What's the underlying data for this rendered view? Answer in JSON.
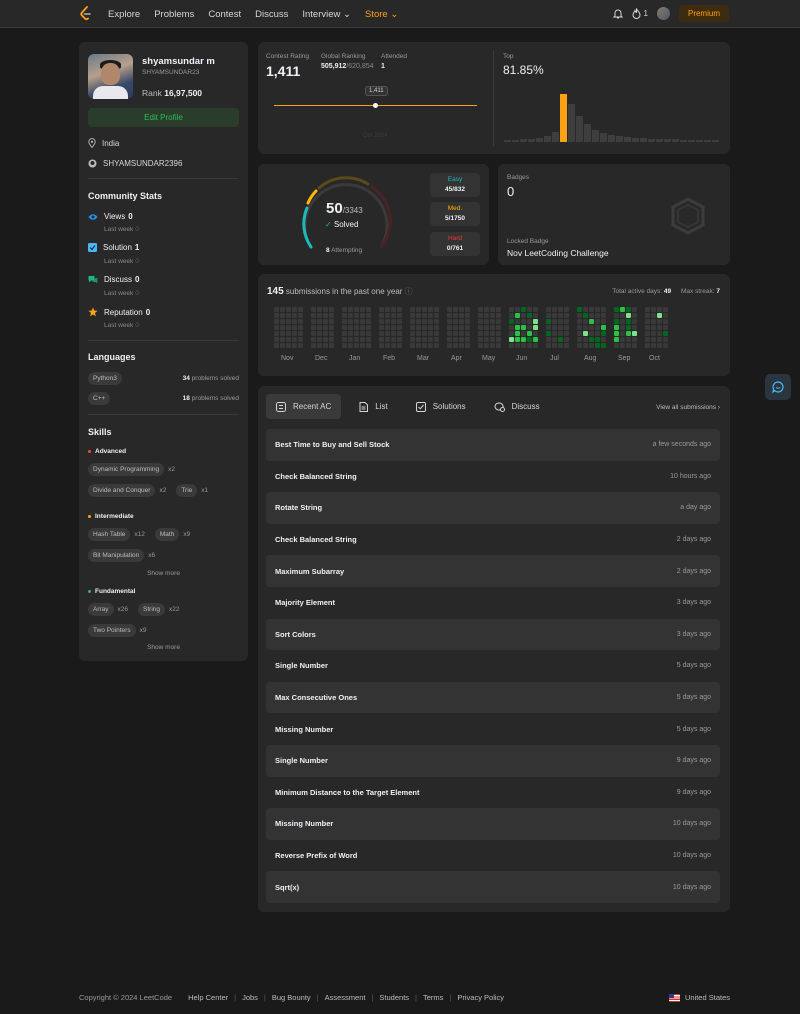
{
  "nav": {
    "links": [
      "Explore",
      "Problems",
      "Contest",
      "Discuss",
      "Interview"
    ],
    "store": "Store",
    "streak": "1",
    "premium": "Premium"
  },
  "profile": {
    "name": "shyamsundar m",
    "username": "SHYAMSUNDAR23",
    "rank_label": "Rank",
    "rank": "16,97,500",
    "edit_label": "Edit Profile",
    "location": "India",
    "github": "SHYAMSUNDAR2396"
  },
  "community": {
    "title": "Community Stats",
    "last_week": "Last week",
    "stats": [
      {
        "label": "Views",
        "value": "0",
        "delta": "0",
        "color": "#2196f3"
      },
      {
        "label": "Solution",
        "value": "1",
        "delta": "0",
        "color": "#48b9f5"
      },
      {
        "label": "Discuss",
        "value": "0",
        "delta": "0",
        "color": "#1fb58a"
      },
      {
        "label": "Reputation",
        "value": "0",
        "delta": "0",
        "color": "#ffa116"
      }
    ]
  },
  "languages": {
    "title": "Languages",
    "suffix": "problems solved",
    "items": [
      {
        "name": "Python3",
        "count": "34"
      },
      {
        "name": "C++",
        "count": "18"
      }
    ]
  },
  "skills": {
    "title": "Skills",
    "show_more": "Show more",
    "advanced": {
      "label": "Advanced",
      "color": "#ef4743",
      "items": [
        [
          "Dynamic Programming",
          "x2"
        ],
        [
          "Divide and Conquer",
          "x2"
        ],
        [
          "Trie",
          "x1"
        ]
      ]
    },
    "intermediate": {
      "label": "Intermediate",
      "color": "#ffa116",
      "items": [
        [
          "Hash Table",
          "x12"
        ],
        [
          "Math",
          "x9"
        ],
        [
          "Bit Manipulation",
          "x6"
        ]
      ]
    },
    "fundamental": {
      "label": "Fundamental",
      "color": "#2cbb5d",
      "items": [
        [
          "Array",
          "x26"
        ],
        [
          "String",
          "x22"
        ],
        [
          "Two Pointers",
          "x9"
        ]
      ]
    }
  },
  "contest": {
    "rating_label": "Contest Rating",
    "rating": "1,411",
    "global_label": "Global Ranking",
    "global": "505,912",
    "global_total": "/620,854",
    "attended_label": "Attended",
    "attended": "1",
    "marker": "1,411",
    "faded_date": "Oct 2024",
    "top_label": "Top",
    "top": "81.85%",
    "histogram": [
      2,
      2,
      3,
      3,
      4,
      6,
      10,
      48,
      38,
      26,
      18,
      12,
      9,
      7,
      6,
      5,
      4,
      4,
      3,
      3,
      3,
      3,
      2,
      2,
      2,
      2,
      2
    ],
    "highlight_index": 7
  },
  "solved": {
    "count": "50",
    "total": "/3343",
    "label": "Solved",
    "attempting_count": "8",
    "attempting": "Attempting",
    "easy": {
      "label": "Easy",
      "value": "45/832",
      "color": "#1cbaba"
    },
    "medium": {
      "label": "Med.",
      "value": "5/1750",
      "color": "#ffb700"
    },
    "hard": {
      "label": "Hard",
      "value": "0/761",
      "color": "#f63737"
    }
  },
  "badges": {
    "label": "Badges",
    "count": "0",
    "locked_label": "Locked Badge",
    "locked_name": "Nov LeetCoding Challenge"
  },
  "submissions": {
    "count": "145",
    "text": "submissions in the past one year",
    "active_label": "Total active days:",
    "active": "49",
    "streak_label": "Max streak:",
    "streak": "7",
    "months": [
      "Nov",
      "Dec",
      "Jan",
      "Feb",
      "Mar",
      "Apr",
      "May",
      "Jun",
      "Jul",
      "Aug",
      "Sep",
      "Oct"
    ]
  },
  "recent": {
    "tabs": [
      "Recent AC",
      "List",
      "Solutions",
      "Discuss"
    ],
    "view_all": "View all submissions",
    "items": [
      {
        "title": "Best Time to Buy and Sell Stock",
        "ago": "a few seconds ago"
      },
      {
        "title": "Check Balanced String",
        "ago": "10 hours ago"
      },
      {
        "title": "Rotate String",
        "ago": "a day ago"
      },
      {
        "title": "Check Balanced String",
        "ago": "2 days ago"
      },
      {
        "title": "Maximum Subarray",
        "ago": "2 days ago"
      },
      {
        "title": "Majority Element",
        "ago": "3 days ago"
      },
      {
        "title": "Sort Colors",
        "ago": "3 days ago"
      },
      {
        "title": "Single Number",
        "ago": "5 days ago"
      },
      {
        "title": "Max Consecutive Ones",
        "ago": "5 days ago"
      },
      {
        "title": "Missing Number",
        "ago": "5 days ago"
      },
      {
        "title": "Single Number",
        "ago": "9 days ago"
      },
      {
        "title": "Minimum Distance to the Target Element",
        "ago": "9 days ago"
      },
      {
        "title": "Missing Number",
        "ago": "10 days ago"
      },
      {
        "title": "Reverse Prefix of Word",
        "ago": "10 days ago"
      },
      {
        "title": "Sqrt(x)",
        "ago": "10 days ago"
      }
    ]
  },
  "footer": {
    "copyright": "Copyright © 2024 LeetCode",
    "links": [
      "Help Center",
      "Jobs",
      "Bug Bounty",
      "Assessment",
      "Students",
      "Terms",
      "Privacy Policy"
    ],
    "country": "United States"
  }
}
